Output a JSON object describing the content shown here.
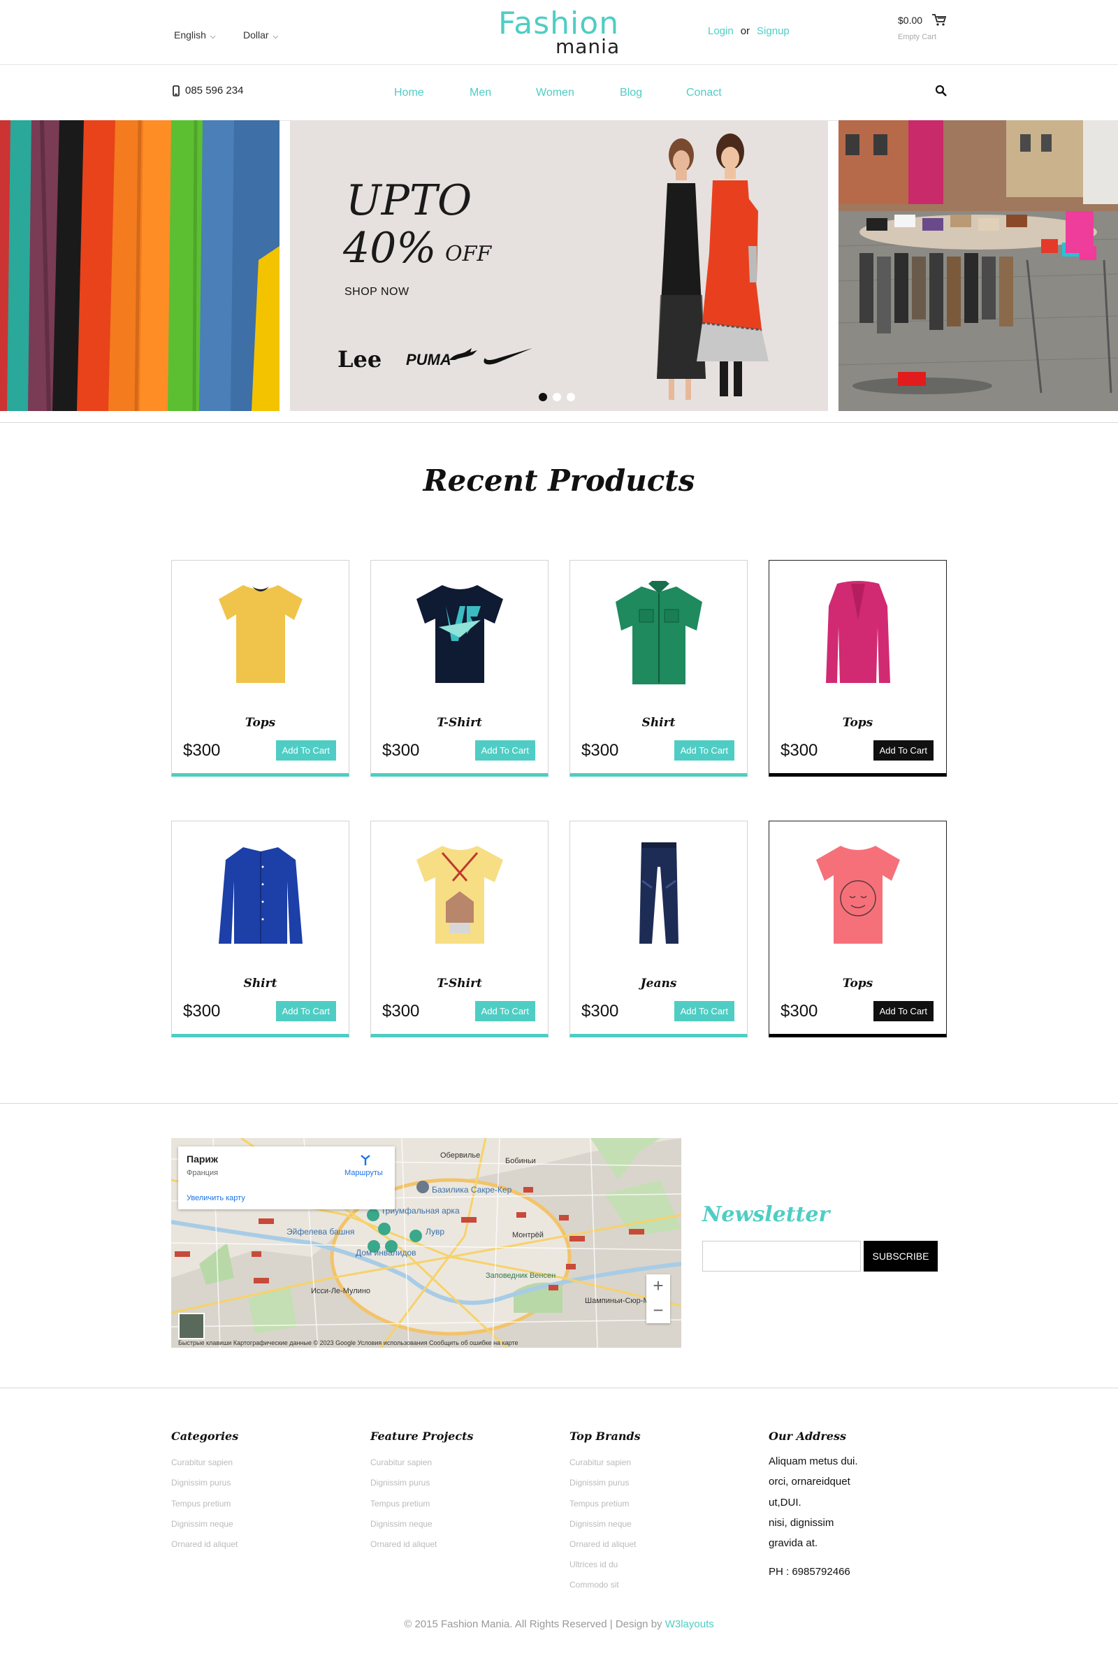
{
  "header": {
    "language": "English",
    "currency": "Dollar",
    "logo_top": "Fashion",
    "logo_bottom": "mania",
    "login": "Login",
    "or": "or",
    "signup": "Signup",
    "cart_amount": "$0.00",
    "cart_status": "Empty Cart"
  },
  "nav": {
    "phone": "085 596 234",
    "links": [
      "Home",
      "Men",
      "Women",
      "Blog",
      "Conact"
    ]
  },
  "banner": {
    "upto": "UPTO",
    "percent": "40%",
    "off": "OFF",
    "shop_now": "SHOP NOW",
    "brands": [
      "Lee",
      "PUMA"
    ]
  },
  "products": {
    "title": "Recent Products",
    "items": [
      {
        "name": "Tops",
        "price": "$300",
        "button": "Add To Cart",
        "color": "#f0c44a"
      },
      {
        "name": "T-Shirt",
        "price": "$300",
        "button": "Add To Cart",
        "color": "#0f1a33"
      },
      {
        "name": "Shirt",
        "price": "$300",
        "button": "Add To Cart",
        "color": "#1e8a5e"
      },
      {
        "name": "Tops",
        "price": "$300",
        "button": "Add To Cart",
        "color": "#d12a72"
      },
      {
        "name": "Shirt",
        "price": "$300",
        "button": "Add To Cart",
        "color": "#1c3fa8"
      },
      {
        "name": "T-Shirt",
        "price": "$300",
        "button": "Add To Cart",
        "color": "#f7de84"
      },
      {
        "name": "Jeans",
        "price": "$300",
        "button": "Add To Cart",
        "color": "#1d2c55"
      },
      {
        "name": "Tops",
        "price": "$300",
        "button": "Add To Cart",
        "color": "#f6707a"
      }
    ]
  },
  "map": {
    "place": "Париж",
    "country": "Франция",
    "enlarge": "Увеличить карту",
    "routes": "Маршруты",
    "labels": [
      "Базилика Сакре-Кер",
      "Триумфальная арка",
      "Эйфелева башня",
      "Лувр",
      "Дом инвалидов",
      "Заповедник Венсен",
      "Обервилье",
      "Бобиньи",
      "Исси-Ле-Мулино",
      "Монтрёй",
      "Шампиньи-Сюр-Марн"
    ],
    "footer": "Быстрые клавиши   Картографические данные © 2023 Google   Условия использования   Сообщить об ошибке на карте",
    "zoom_in": "+",
    "zoom_out": "−"
  },
  "newsletter": {
    "title": "Newsletter",
    "placeholder": "",
    "button": "SUBSCRIBE"
  },
  "footer": {
    "categories": {
      "title": "Categories",
      "links": [
        "Curabitur sapien",
        "Dignissim purus",
        "Tempus pretium",
        "Dignissim neque",
        "Ornared id aliquet"
      ]
    },
    "projects": {
      "title": "Feature Projects",
      "links": [
        "Curabitur sapien",
        "Dignissim purus",
        "Tempus pretium",
        "Dignissim neque",
        "Ornared id aliquet"
      ]
    },
    "brands": {
      "title": "Top Brands",
      "links": [
        "Curabitur sapien",
        "Dignissim purus",
        "Tempus pretium",
        "Dignissim neque",
        "Ornared id aliquet",
        "Ultrices id du",
        "Commodo sit"
      ]
    },
    "address": {
      "title": "Our Address",
      "lines": [
        "Aliquam metus dui.",
        "orci, ornareidquet",
        "ut,DUI.",
        "nisi, dignissim",
        "gravida at."
      ],
      "phone": "PH : 6985792466"
    },
    "copyright": "© 2015 Fashion Mania. All Rights Reserved | Design by",
    "designer": "W3layouts"
  }
}
